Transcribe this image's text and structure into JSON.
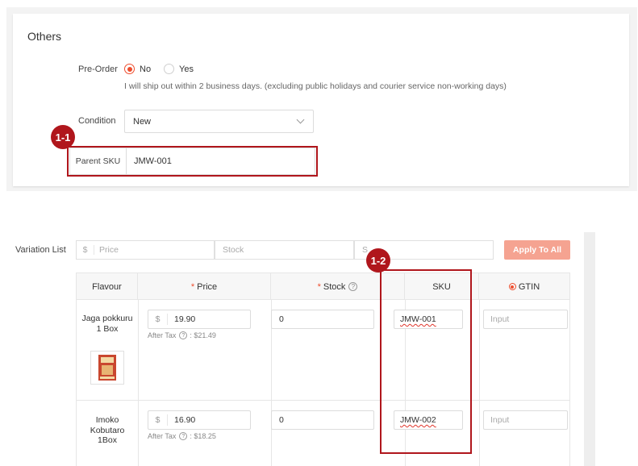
{
  "others": {
    "title": "Others",
    "preorder": {
      "label": "Pre-Order",
      "options": [
        "No",
        "Yes"
      ],
      "selected": "No",
      "help": "I will ship out within 2 business days. (excluding public holidays and courier service non-working days)"
    },
    "condition": {
      "label": "Condition",
      "value": "New"
    },
    "parent_sku": {
      "label": "Parent SKU",
      "value": "JMW-001"
    }
  },
  "annotations": {
    "badge1": "1-1",
    "badge2": "1-2"
  },
  "variation": {
    "label": "Variation List",
    "batch": {
      "currency": "$",
      "price_placeholder": "Price",
      "stock_placeholder": "Stock",
      "sku_placeholder": "S"
    },
    "apply_label": "Apply To All",
    "columns": {
      "flavour": "Flavour",
      "price": "Price",
      "stock": "Stock",
      "sku": "SKU",
      "gtin": "GTIN"
    },
    "rows": [
      {
        "flavour": "Jaga pokkuru 1 Box",
        "currency": "$",
        "price": "19.90",
        "after_tax_label": "After Tax",
        "after_tax": ": $21.49",
        "stock": "0",
        "sku": "JMW-001",
        "gtin_placeholder": "Input"
      },
      {
        "flavour": "Imoko Kobutaro 1Box",
        "currency": "$",
        "price": "16.90",
        "after_tax_label": "After Tax",
        "after_tax": ": $18.25",
        "stock": "0",
        "sku": "JMW-002",
        "gtin_placeholder": "Input"
      }
    ]
  },
  "colors": {
    "accent": "#ee4d2d",
    "annotation": "#b0161c",
    "apply_button": "#f5a391"
  }
}
